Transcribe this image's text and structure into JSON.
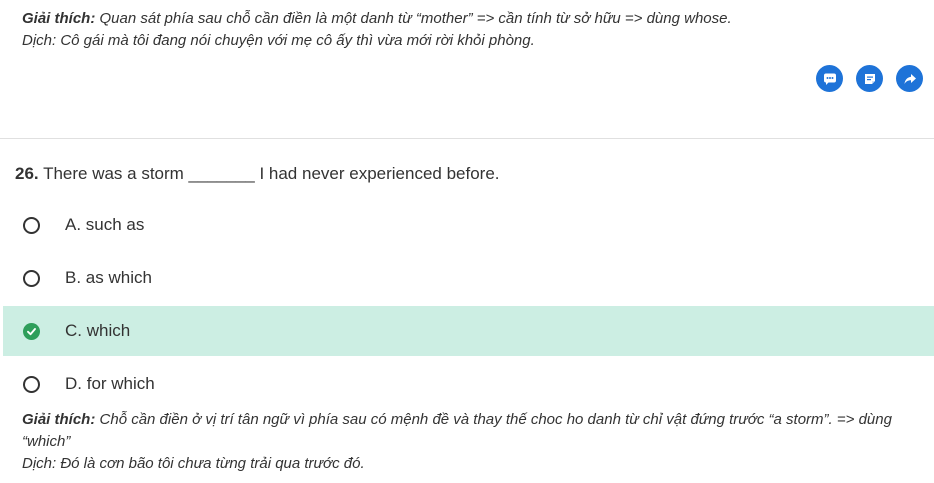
{
  "prev_explanation": {
    "label": "Giải thích:",
    "text": "Quan sát phía sau chỗ cần điền là một danh từ “mother” => cần tính từ sở hữu => dùng whose.",
    "translation": "Dịch: Cô gái mà tôi đang nói chuyện với mẹ cô ấy thì vừa mới rời khỏi phòng."
  },
  "actions": {
    "comment_icon": "comment-icon",
    "note_icon": "note-icon",
    "share_icon": "share-icon",
    "accent_color": "#1e73d8"
  },
  "question": {
    "number": "26.",
    "text": "There was a storm _______ I had never experienced before."
  },
  "options": [
    {
      "label": "A. such as",
      "state": "unselected"
    },
    {
      "label": "B. as which",
      "state": "unselected"
    },
    {
      "label": "C. which",
      "state": "correct"
    },
    {
      "label": "D. for which",
      "state": "unselected"
    }
  ],
  "explanation": {
    "label": "Giải thích:",
    "text": "Chỗ cần điền ở vị trí tân ngữ vì phía sau có mệnh đề và thay thế choc ho danh từ chỉ vật đứng trước “a storm”. => dùng “which”",
    "translation": "Dịch: Đó là cơn bão tôi chưa từng trải qua trước đó."
  },
  "colors": {
    "correct_bg": "#cceee3",
    "correct_check": "#2e9e5b"
  }
}
